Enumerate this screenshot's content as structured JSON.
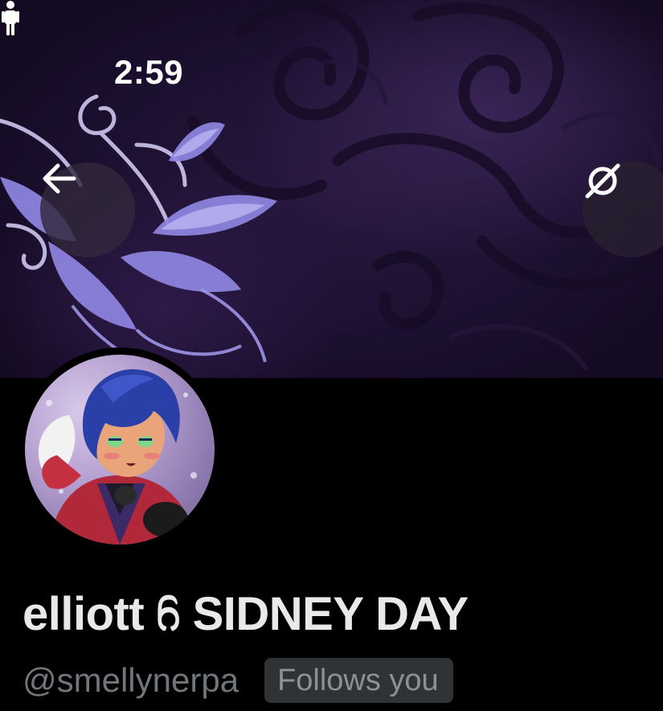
{
  "status_bar": {
    "time": "2:59",
    "accessibility_icon": "person-standing-icon"
  },
  "header": {
    "back_icon": "arrow-left-icon",
    "more_icon": "no-symbol-icon"
  },
  "profile": {
    "display_name": "elliott ᦆ SIDNEY DAY",
    "handle": "@smellynerpa",
    "follows_badge": "Follows you"
  },
  "colors": {
    "background": "#000000",
    "name_text": "#e7e9ea",
    "handle_text": "#71767b",
    "badge_bg": "#2f3336",
    "banner_accent": "#7b6ad6"
  }
}
